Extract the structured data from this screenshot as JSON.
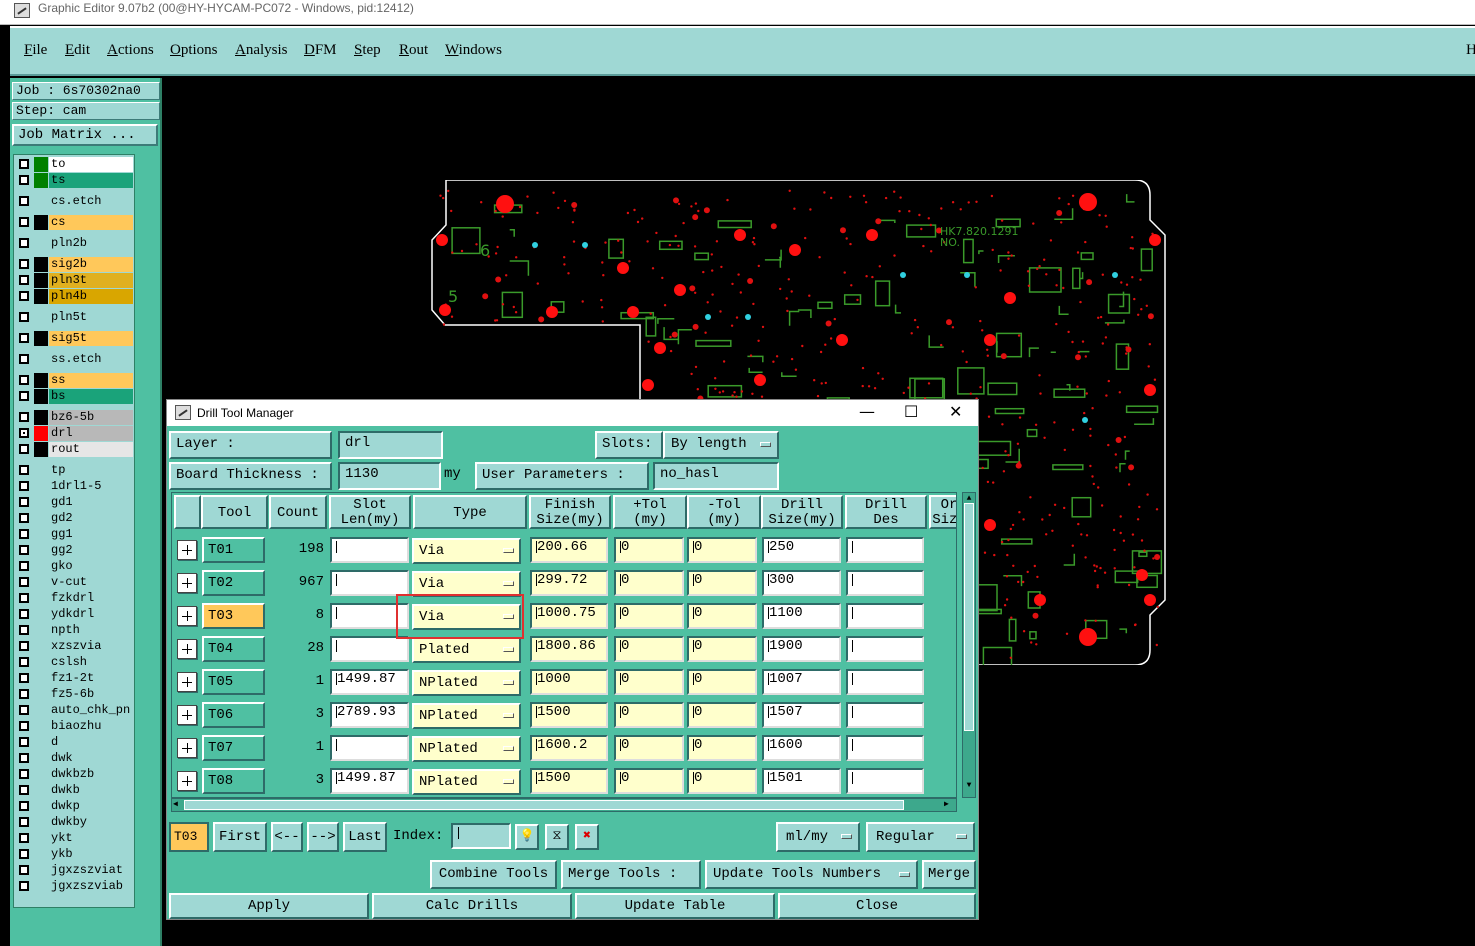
{
  "app": {
    "title": "Graphic Editor 9.07b2 (00@HY-HYCAM-PC072 - Windows, pid:12412)"
  },
  "menu": {
    "items": [
      "File",
      "Edit",
      "Actions",
      "Options",
      "Analysis",
      "DFM",
      "Step",
      "Rout",
      "Windows"
    ],
    "right_label": "H"
  },
  "job": {
    "job_label": "Job : 6s70302na0",
    "step_label": "Step: cam",
    "matrix_button": "Job Matrix ..."
  },
  "layers": [
    {
      "name": "to",
      "swatch": "#008000",
      "bg": "#ffffff",
      "checked": false
    },
    {
      "name": "ts",
      "swatch": "#008000",
      "bg": "#1aa37a",
      "checked": false
    },
    {
      "name": "cs.etch",
      "swatch": "#9fd8d4",
      "bg": "#9fd8d4",
      "checked": false
    },
    {
      "name": "cs",
      "swatch": "#000000",
      "bg": "#ffc85a",
      "checked": false
    },
    {
      "name": "pln2b",
      "swatch": "#9fd8d4",
      "bg": "#9fd8d4",
      "checked": false
    },
    {
      "name": "sig2b",
      "swatch": "#000000",
      "bg": "#ffc85a",
      "checked": false
    },
    {
      "name": "pln3t",
      "swatch": "#000000",
      "bg": "#e0b020",
      "checked": false
    },
    {
      "name": "pln4b",
      "swatch": "#000000",
      "bg": "#d9a600",
      "checked": false
    },
    {
      "name": "pln5t",
      "swatch": "#9fd8d4",
      "bg": "#9fd8d4",
      "checked": false
    },
    {
      "name": "sig5t",
      "swatch": "#000000",
      "bg": "#ffc85a",
      "checked": false
    },
    {
      "name": "ss.etch",
      "swatch": "#9fd8d4",
      "bg": "#9fd8d4",
      "checked": false
    },
    {
      "name": "ss",
      "swatch": "#000000",
      "bg": "#ffc85a",
      "checked": false
    },
    {
      "name": "bs",
      "swatch": "#000000",
      "bg": "#1aa37a",
      "checked": false
    },
    {
      "name": "bz6-5b",
      "swatch": "#000000",
      "bg": "#b8b8b8",
      "checked": false
    },
    {
      "name": "drl",
      "swatch": "#ff0000",
      "bg": "#b8b8b8",
      "checked": true,
      "mark": "⊞"
    },
    {
      "name": "rout",
      "swatch": "#000000",
      "bg": "#e6e6e6",
      "checked": false
    },
    {
      "name": "tp",
      "swatch": "#9fd8d4",
      "bg": "#9fd8d4",
      "checked": false
    },
    {
      "name": "1drl1-5",
      "swatch": "#9fd8d4",
      "bg": "#9fd8d4",
      "checked": false
    },
    {
      "name": "gd1",
      "swatch": "#9fd8d4",
      "bg": "#9fd8d4",
      "checked": false
    },
    {
      "name": "gd2",
      "swatch": "#9fd8d4",
      "bg": "#9fd8d4",
      "checked": false
    },
    {
      "name": "gg1",
      "swatch": "#9fd8d4",
      "bg": "#9fd8d4",
      "checked": false
    },
    {
      "name": "gg2",
      "swatch": "#9fd8d4",
      "bg": "#9fd8d4",
      "checked": false
    },
    {
      "name": "gko",
      "swatch": "#9fd8d4",
      "bg": "#9fd8d4",
      "checked": false
    },
    {
      "name": "v-cut",
      "swatch": "#9fd8d4",
      "bg": "#9fd8d4",
      "checked": false
    },
    {
      "name": "fzkdrl",
      "swatch": "#9fd8d4",
      "bg": "#9fd8d4",
      "checked": false
    },
    {
      "name": "ydkdrl",
      "swatch": "#9fd8d4",
      "bg": "#9fd8d4",
      "checked": false
    },
    {
      "name": "npth",
      "swatch": "#9fd8d4",
      "bg": "#9fd8d4",
      "checked": false
    },
    {
      "name": "xzszvia",
      "swatch": "#9fd8d4",
      "bg": "#9fd8d4",
      "checked": false
    },
    {
      "name": "cslsh",
      "swatch": "#9fd8d4",
      "bg": "#9fd8d4",
      "checked": false
    },
    {
      "name": "fz1-2t",
      "swatch": "#9fd8d4",
      "bg": "#9fd8d4",
      "checked": false
    },
    {
      "name": "fz5-6b",
      "swatch": "#9fd8d4",
      "bg": "#9fd8d4",
      "checked": false
    },
    {
      "name": "auto_chk_pn",
      "swatch": "#9fd8d4",
      "bg": "#9fd8d4",
      "checked": false
    },
    {
      "name": "biaozhu",
      "swatch": "#9fd8d4",
      "bg": "#9fd8d4",
      "checked": false
    },
    {
      "name": "d",
      "swatch": "#9fd8d4",
      "bg": "#9fd8d4",
      "checked": false
    },
    {
      "name": "dwk",
      "swatch": "#9fd8d4",
      "bg": "#9fd8d4",
      "checked": false
    },
    {
      "name": "dwkbzb",
      "swatch": "#9fd8d4",
      "bg": "#9fd8d4",
      "checked": false
    },
    {
      "name": "dwkb",
      "swatch": "#9fd8d4",
      "bg": "#9fd8d4",
      "checked": false
    },
    {
      "name": "dwkp",
      "swatch": "#9fd8d4",
      "bg": "#9fd8d4",
      "checked": false
    },
    {
      "name": "dwkby",
      "swatch": "#9fd8d4",
      "bg": "#9fd8d4",
      "checked": false
    },
    {
      "name": "ykt",
      "swatch": "#9fd8d4",
      "bg": "#9fd8d4",
      "checked": false
    },
    {
      "name": "ykb",
      "swatch": "#9fd8d4",
      "bg": "#9fd8d4",
      "checked": false
    },
    {
      "name": "jgxzszviat",
      "swatch": "#9fd8d4",
      "bg": "#9fd8d4",
      "checked": false
    },
    {
      "name": "jgxzszviab",
      "swatch": "#9fd8d4",
      "bg": "#9fd8d4",
      "checked": false
    }
  ],
  "board": {
    "silk_text": "HK7.820.1291",
    "silk_text2": "NO.",
    "digits": [
      "6",
      "5"
    ]
  },
  "dialog": {
    "title": "Drill Tool Manager",
    "layer_label": "Layer          :",
    "layer_value": "drl",
    "slots_label": "Slots:",
    "slots_value": "By length",
    "thickness_label": "Board Thickness :",
    "thickness_value": "1130",
    "thickness_unit": "my",
    "user_params_label": "User Parameters :",
    "user_params_value": "no_hasl",
    "columns": [
      "Tool",
      "Count",
      "Slot\nLen(my)",
      "Type",
      "Finish\nSize(my)",
      "+Tol\n(my)",
      "-Tol\n(my)",
      "Drill\nSize(my)",
      "Drill\nDes",
      "Or\nSize"
    ],
    "rows": [
      {
        "tool": "T01",
        "count": "198",
        "slot": "",
        "type": "Via",
        "finish": "200.66",
        "ptol": "0",
        "mtol": "0",
        "drill": "250",
        "des": ""
      },
      {
        "tool": "T02",
        "count": "967",
        "slot": "",
        "type": "Via",
        "finish": "299.72",
        "ptol": "0",
        "mtol": "0",
        "drill": "300",
        "des": ""
      },
      {
        "tool": "T03",
        "count": "8",
        "slot": "",
        "type": "Via",
        "finish": "1000.75",
        "ptol": "0",
        "mtol": "0",
        "drill": "1100",
        "des": ""
      },
      {
        "tool": "T04",
        "count": "28",
        "slot": "",
        "type": "Plated",
        "finish": "1800.86",
        "ptol": "0",
        "mtol": "0",
        "drill": "1900",
        "des": ""
      },
      {
        "tool": "T05",
        "count": "1",
        "slot": "1499.87",
        "type": "NPlated",
        "finish": "1000",
        "ptol": "0",
        "mtol": "0",
        "drill": "1007",
        "des": ""
      },
      {
        "tool": "T06",
        "count": "3",
        "slot": "2789.93",
        "type": "NPlated",
        "finish": "1500",
        "ptol": "0",
        "mtol": "0",
        "drill": "1507",
        "des": ""
      },
      {
        "tool": "T07",
        "count": "1",
        "slot": "",
        "type": "NPlated",
        "finish": "1600.2",
        "ptol": "0",
        "mtol": "0",
        "drill": "1600",
        "des": ""
      },
      {
        "tool": "T08",
        "count": "3",
        "slot": "1499.87",
        "type": "NPlated",
        "finish": "1500",
        "ptol": "0",
        "mtol": "0",
        "drill": "1501",
        "des": ""
      }
    ],
    "selected_tool": "T03",
    "nav": {
      "current": "T03",
      "first": "First",
      "prev": "<--",
      "next": "-->",
      "last": "Last",
      "index_label": "Index:"
    },
    "units_value": "ml/my",
    "mode_value": "Regular",
    "combine_button": "Combine Tools",
    "merge_tools_label": "Merge Tools :",
    "update_numbers_value": "Update Tools Numbers",
    "merge_button": "Merge",
    "apply_button": "Apply",
    "calc_button": "Calc Drills",
    "update_table_button": "Update Table",
    "close_button": "Close"
  }
}
